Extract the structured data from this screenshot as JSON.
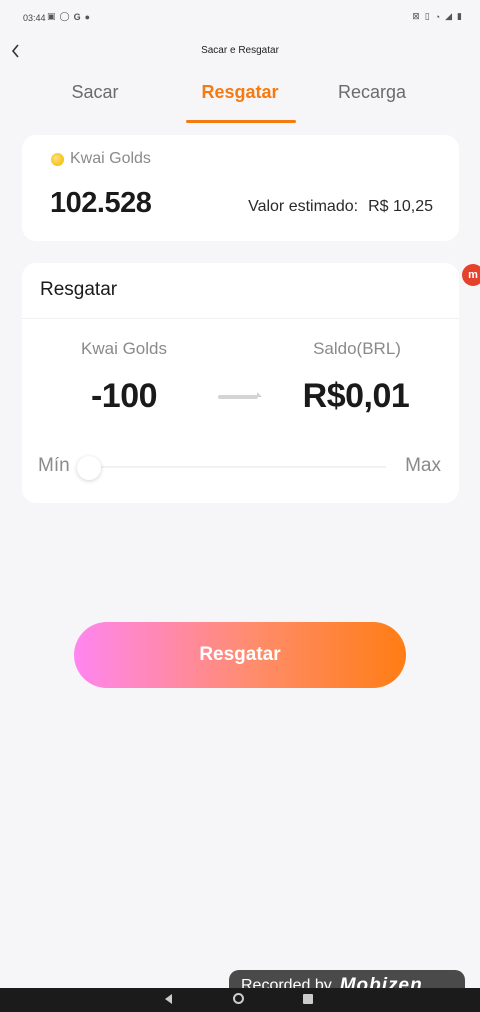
{
  "status_bar": {
    "time": "03:44",
    "left_icons": [
      "notification-icon",
      "whatsapp-icon",
      "google-icon",
      "app-icon"
    ],
    "right_icons": [
      "alarm-icon",
      "vibrate-icon",
      "wifi-icon",
      "signal-icon",
      "battery-icon"
    ]
  },
  "header": {
    "title": "Sacar e Resgatar",
    "back_icon": "chevron-left-icon"
  },
  "tabs": [
    {
      "label": "Sacar",
      "active": false
    },
    {
      "label": "Resgatar",
      "active": true
    },
    {
      "label": "Recarga",
      "active": false
    }
  ],
  "balance": {
    "label": "Kwai Golds",
    "value": "102.528",
    "estimate_label": "Valor estimado:",
    "estimate_value": "R$ 10,25"
  },
  "redeem": {
    "title": "Resgatar",
    "from_label": "Kwai Golds",
    "from_value": "-100",
    "to_label": "Saldo(BRL)",
    "to_value": "R$0,01",
    "min_label": "Mín",
    "max_label": "Max",
    "slider_position": 0.0
  },
  "cta": {
    "label": "Resgatar"
  },
  "side_badge": {
    "label": "m"
  },
  "recorder": {
    "label": "Recorded by",
    "brand": "Mobizen"
  },
  "colors": {
    "accent": "#f57a10",
    "background": "#f6f6f8",
    "cta_gradient_start": "#ff86f0",
    "cta_gradient_end": "#ff7d14"
  }
}
